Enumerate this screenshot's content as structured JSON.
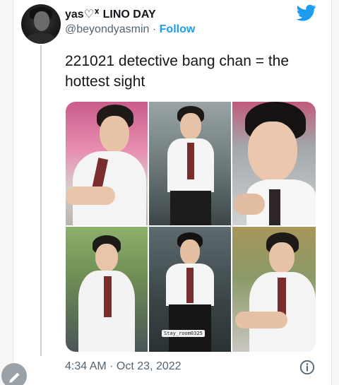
{
  "tweet": {
    "display_name": "yas♡ᕁ LINO DAY",
    "handle": "@beyondyasmin",
    "separator": "·",
    "follow_label": "Follow",
    "text_line1": "221021 detective bang chan = the",
    "text_line2": "hottest sight",
    "timestamp": "4:34 AM · Oct 23, 2022"
  },
  "media": {
    "watermark": "Stay_room0325"
  },
  "icons": {
    "brand": "twitter-bird-icon",
    "info": "info-icon",
    "compose": "compose-icon"
  },
  "colors": {
    "accent": "#1d9bf0",
    "text": "#14171a",
    "secondary": "#536471"
  }
}
